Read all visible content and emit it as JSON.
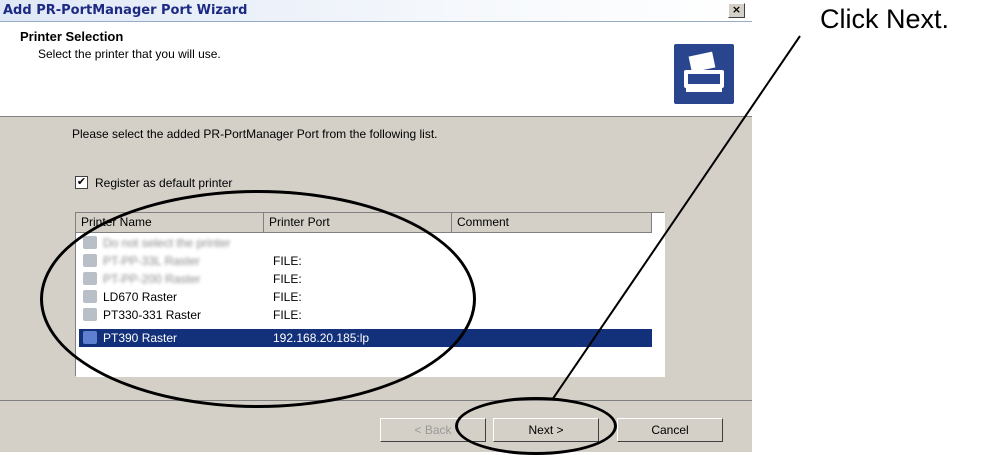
{
  "window": {
    "title": "Add PR-PortManager Port Wizard",
    "close_glyph": "×"
  },
  "header": {
    "title": "Printer Selection",
    "subtitle": "Select the printer that you will use.",
    "icon": "printer-wizard-icon"
  },
  "main": {
    "instruction": "Please select the added PR-PortManager Port from the following list.",
    "default_checkbox": {
      "checked": true,
      "glyph": "✔",
      "label": "Register as default printer"
    }
  },
  "printer_list": {
    "columns": [
      "Printer Name",
      "Printer Port",
      "Comment"
    ],
    "rows": [
      {
        "name": "Do not select the printer",
        "port": "",
        "obscured": true
      },
      {
        "name": "PT-PP-33L Raster",
        "port": "FILE:",
        "obscured": true
      },
      {
        "name": "PT-PP-200 Raster",
        "port": "FILE:",
        "obscured": true
      },
      {
        "name": "LD670 Raster",
        "port": "FILE:"
      },
      {
        "name": "PT330-331 Raster",
        "port": "FILE:"
      },
      {
        "name": "PT390 Raster",
        "port": "192.168.20.185:lp",
        "selected": true
      }
    ]
  },
  "buttons": {
    "back": "< Back",
    "next": "Next >",
    "cancel": "Cancel"
  },
  "annotation": {
    "callout": "Click Next."
  }
}
